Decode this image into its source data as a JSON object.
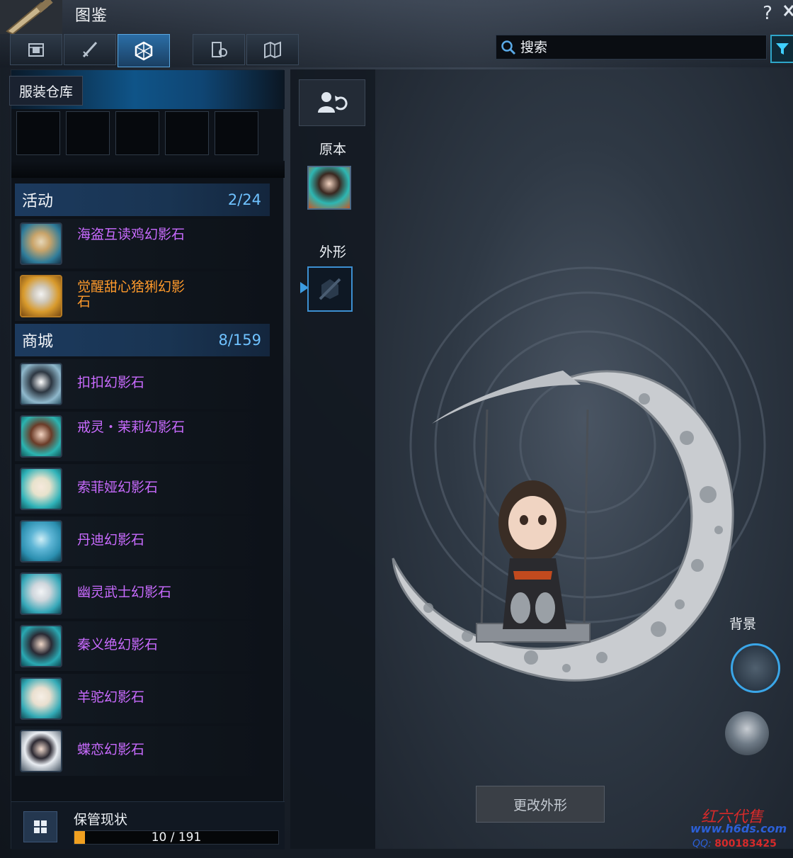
{
  "window": {
    "title": "图鉴",
    "help": "?"
  },
  "tabs": [
    {
      "name": "tab-outfit-box",
      "icon": "chest-icon",
      "active": false
    },
    {
      "name": "tab-weapon",
      "icon": "sword-icon",
      "active": false
    },
    {
      "name": "tab-phantom-stone",
      "icon": "gem-icon",
      "active": true
    },
    {
      "name": "tab-collection",
      "icon": "book-gear-icon",
      "active": false
    },
    {
      "name": "tab-map",
      "icon": "map-icon",
      "active": false
    }
  ],
  "search": {
    "placeholder": "搜索"
  },
  "wardrobe": {
    "label": "服装仓库"
  },
  "sections": {
    "event": {
      "title": "活动",
      "count": "2/24"
    },
    "shop": {
      "title": "商城",
      "count": "8/159"
    }
  },
  "event_items": [
    {
      "name": "海盗互读鸡幻影石",
      "color": "#c96bff"
    },
    {
      "name": "觉醒甜心猞猁幻影石",
      "color": "#ff9a2b"
    }
  ],
  "shop_items": [
    {
      "name": "扣扣幻影石",
      "color": "#c96bff"
    },
    {
      "name": "戒灵・茉莉幻影石",
      "color": "#c96bff"
    },
    {
      "name": "索菲娅幻影石",
      "color": "#c96bff"
    },
    {
      "name": "丹迪幻影石",
      "color": "#c96bff"
    },
    {
      "name": "幽灵武士幻影石",
      "color": "#c96bff"
    },
    {
      "name": "秦义绝幻影石",
      "color": "#c96bff"
    },
    {
      "name": "羊驼幻影石",
      "color": "#c96bff"
    },
    {
      "name": "蝶恋幻影石",
      "color": "#c96bff"
    }
  ],
  "storage": {
    "label": "保管现状",
    "current": 10,
    "total": 191,
    "text": "10 / 191"
  },
  "preview": {
    "original_label": "原本",
    "appearance_label": "外形",
    "background_label": "背景",
    "change_button": "更改外形"
  },
  "watermark": {
    "brand": "红六代售",
    "url": "www.h6ds.com",
    "qq_label": "QQ:",
    "qq_number": "800183425"
  }
}
